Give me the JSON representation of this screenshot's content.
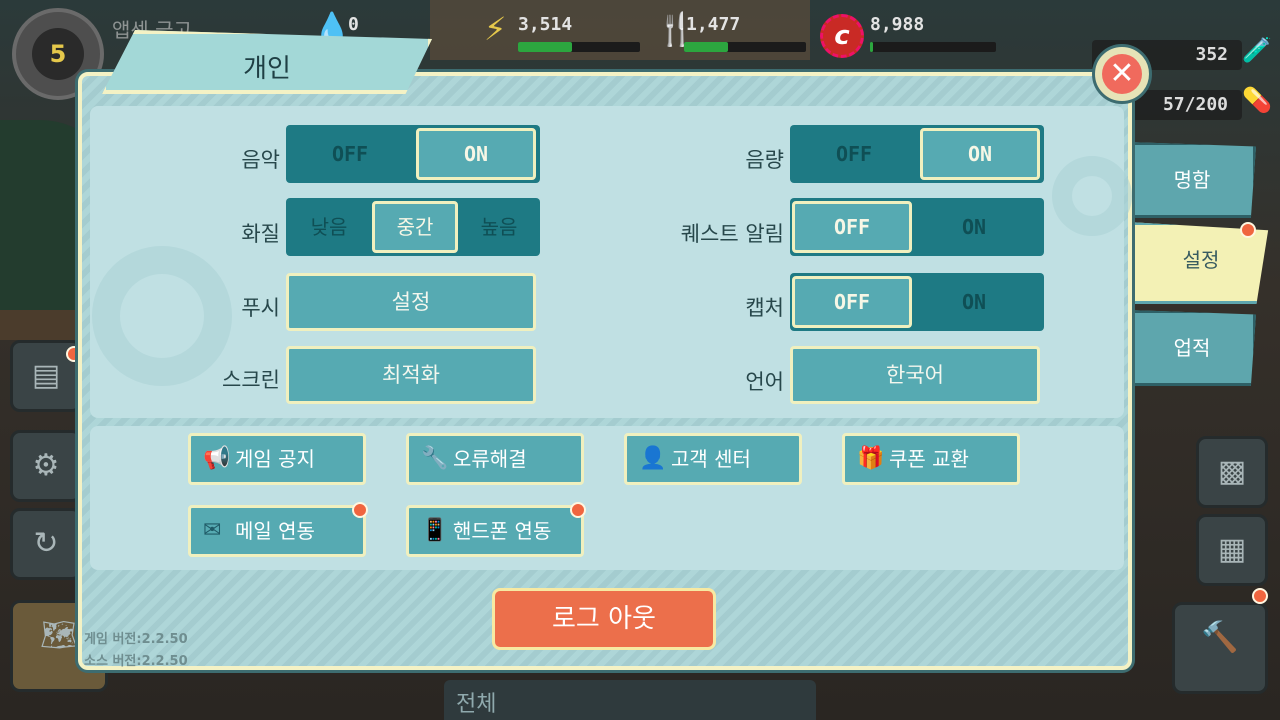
{
  "hud": {
    "level": "5",
    "vault_name": "앱센 금고",
    "water": "0",
    "power": "3,514",
    "power_fill": 0.44,
    "food": "1,477",
    "food_fill": 0.36,
    "caps": "8,988",
    "caps_fill": 0.02,
    "nuka": "352",
    "dwellers": "57/200",
    "bottom_tab": "전체"
  },
  "dialog": {
    "title": "개인",
    "close_label": "✕"
  },
  "settings": {
    "music": {
      "label": "음악",
      "off": "OFF",
      "on": "ON",
      "value": "ON"
    },
    "volume": {
      "label": "음량",
      "off": "OFF",
      "on": "ON",
      "value": "ON"
    },
    "quality": {
      "label": "화질",
      "low": "낮음",
      "mid": "중간",
      "high": "높음",
      "value": "중간"
    },
    "quest_alert": {
      "label": "퀘스트 알림",
      "off": "OFF",
      "on": "ON",
      "value": "OFF"
    },
    "push": {
      "label": "푸시",
      "button": "설정"
    },
    "capture": {
      "label": "캡처",
      "off": "OFF",
      "on": "ON",
      "value": "OFF"
    },
    "screen": {
      "label": "스크린",
      "button": "최적화"
    },
    "language": {
      "label": "언어",
      "button": "한국어"
    }
  },
  "services": [
    {
      "label": "게임 공지",
      "icon": "megaphone-icon"
    },
    {
      "label": "오류해결",
      "icon": "wrench-icon"
    },
    {
      "label": "고객 센터",
      "icon": "person-icon"
    },
    {
      "label": "쿠폰 교환",
      "icon": "gift-icon"
    },
    {
      "label": "메일 연동",
      "icon": "mail-icon"
    },
    {
      "label": "핸드폰 연동",
      "icon": "phone-icon"
    }
  ],
  "logout_label": "로그 아웃",
  "version": {
    "game": "게임 버전:2.2.50",
    "source": "소스 버전:2.2.50"
  },
  "tabs": [
    {
      "label": "명함"
    },
    {
      "label": "설정"
    },
    {
      "label": "업적"
    }
  ],
  "colors": {
    "accent": "#56aab2",
    "toggle_bg": "#1e7a84",
    "logout": "#ec6f4b",
    "notify_dot": "#f0653f"
  }
}
